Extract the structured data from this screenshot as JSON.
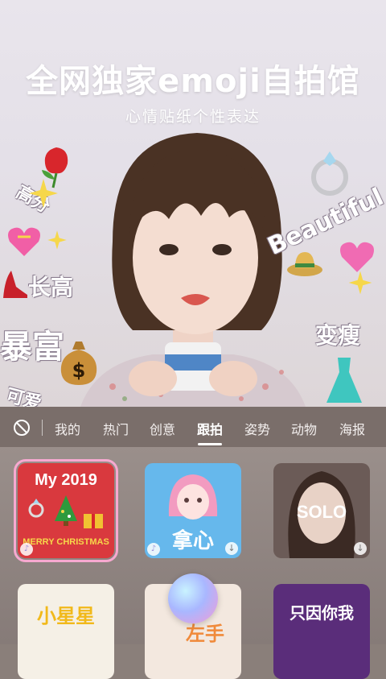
{
  "hero": {
    "headline": "全网独家emoji自拍馆",
    "subheadline": "心情贴纸个性表达",
    "stickers": {
      "tall": "长高",
      "rich": "暴富",
      "slim": "变瘦",
      "beautiful": "Beautiful",
      "score": " 高分",
      "cute": "可爱"
    }
  },
  "tabs": {
    "none_icon": "no-filter-icon",
    "items": [
      "我的",
      "热门",
      "创意",
      "跟拍",
      "姿势",
      "动物",
      "海报"
    ],
    "active": "跟拍"
  },
  "grid": {
    "tile1": {
      "title": "My 2019",
      "footer": "MERRY CHRISTMAS",
      "bg": "#d9393e"
    },
    "tile2": {
      "title": "拿心",
      "bg": "#66b8ec"
    },
    "tile3": {
      "title": "SOLO",
      "bg": "#6b5b57"
    },
    "tile4": {
      "title": "小星星",
      "bg": "#f5f0e6"
    },
    "tile5": {
      "title": "左手",
      "bg": "#f3e8df"
    },
    "tile6": {
      "title": "只因你我",
      "bg": "#5a2d7a"
    }
  },
  "colors": {
    "accent": "#f7a9d0",
    "tabbar": "#786c68"
  }
}
